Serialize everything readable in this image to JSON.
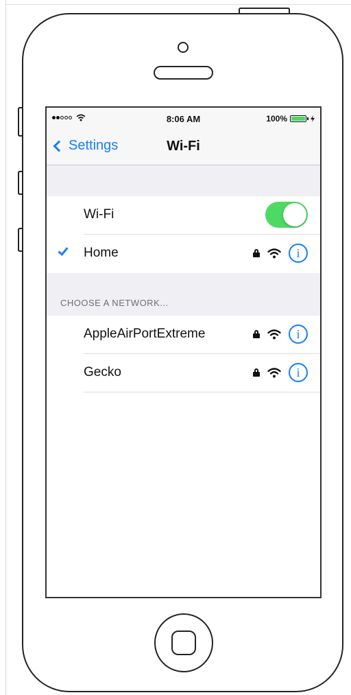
{
  "status_bar": {
    "signal_dots_filled": 2,
    "signal_dots_total": 5,
    "time": "8:06 AM",
    "battery_percent_text": "100%",
    "battery_level": 1.0
  },
  "nav": {
    "back_label": "Settings",
    "title": "Wi-Fi"
  },
  "wifi_toggle": {
    "label": "Wi-Fi",
    "on": true
  },
  "connected_network": {
    "name": "Home",
    "secured": true,
    "info_glyph": "i"
  },
  "section": {
    "choose_network_label": "CHOOSE A NETWORK..."
  },
  "networks": [
    {
      "name": "AppleAirPortExtreme",
      "secured": true,
      "info_glyph": "i"
    },
    {
      "name": "Gecko",
      "secured": true,
      "info_glyph": "i"
    }
  ],
  "colors": {
    "accent": "#157efb",
    "toggle_on": "#4cd964",
    "group_bg": "#efeff4",
    "bar_bg": "#f7f7f7"
  },
  "icons": {
    "back": "chevron-left-icon",
    "checkmark": "checkmark-icon",
    "lock": "lock-icon",
    "wifi": "wifi-icon",
    "info": "info-icon",
    "home_button": "home-button-icon"
  }
}
